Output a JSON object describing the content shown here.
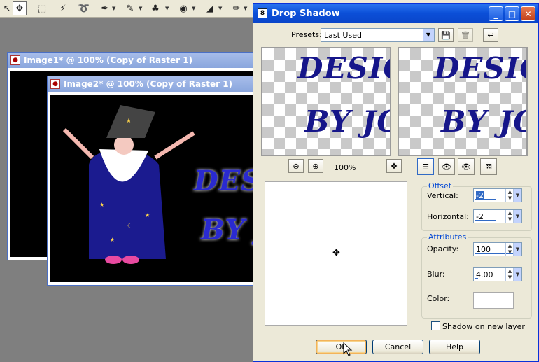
{
  "toolbar": {
    "tools": [
      "arrow-icon",
      "move-icon",
      "selection-icon",
      "magic-wand-icon",
      "lasso-icon",
      "dropper-icon",
      "pen-icon",
      "clone-icon",
      "dodge-icon",
      "fill-icon",
      "eraser-icon",
      "close-icon"
    ]
  },
  "windows": {
    "image1_title": "Image1* @ 100% (Copy of Raster 1)",
    "image2_title": "Image2* @ 100% (Copy of Raster 1)",
    "canvas_text_line1": "DESI",
    "canvas_text_line2": "BY J"
  },
  "dialog": {
    "title": "Drop Shadow",
    "icon_glyph": "8",
    "presets_label": "Presets:",
    "presets_value": "Last Used",
    "preview_line1": "DESIGN",
    "preview_line2": "BY JO",
    "zoom": "100%",
    "offset": {
      "legend": "Offset",
      "vertical_label": "Vertical:",
      "vertical_value": "-2",
      "horizontal_label": "Horizontal:",
      "horizontal_value": "-2"
    },
    "attributes": {
      "legend": "Attributes",
      "opacity_label": "Opacity:",
      "opacity_value": "100",
      "blur_label": "Blur:",
      "blur_value": "4.00",
      "color_label": "Color:",
      "color_value": "#ffffff"
    },
    "shadow_new_layer": "Shadow on new layer",
    "ok": "OK",
    "cancel": "Cancel",
    "help": "Help"
  },
  "colors": {
    "title_blue": "#0b4fd8",
    "text_blue": "#16168a"
  }
}
